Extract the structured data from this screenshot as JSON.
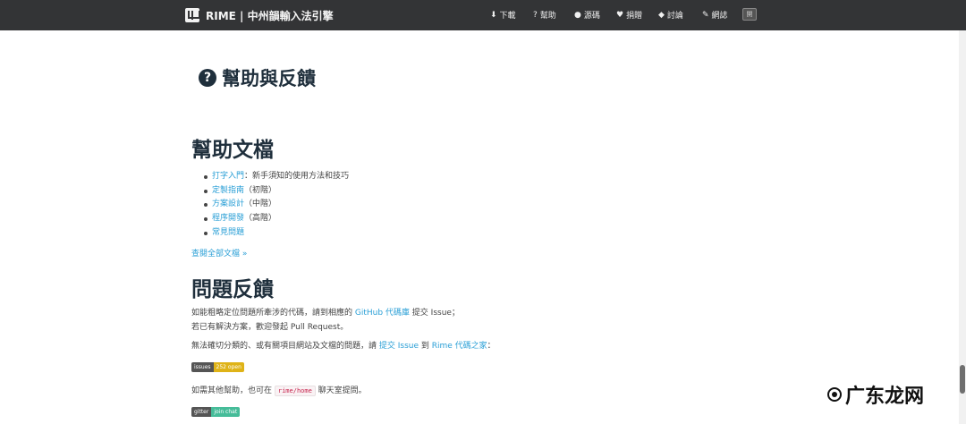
{
  "navbar": {
    "brand": "RIME | 中州韻輸入法引擎",
    "items": [
      {
        "icon": "⬇",
        "icon_name": "download-icon",
        "label": "下載"
      },
      {
        "icon": "?",
        "icon_name": "question-icon",
        "label": "幫助"
      },
      {
        "icon": "●",
        "icon_name": "github-icon",
        "label": "源碼"
      },
      {
        "icon": "♥",
        "icon_name": "heart-icon",
        "label": "捐贈"
      },
      {
        "icon": "◆",
        "icon_name": "chat-icon",
        "label": "討論"
      },
      {
        "icon": "✎",
        "icon_name": "edit-icon",
        "label": "網誌"
      }
    ],
    "toggle": "開"
  },
  "page": {
    "title": "幫助與反饋",
    "title_icon": "?"
  },
  "docs": {
    "heading": "幫助文檔",
    "items": [
      {
        "link": "打字入門",
        "desc": "：新手須知的使用方法和技巧"
      },
      {
        "link": "定製指南",
        "desc": "（初階）"
      },
      {
        "link": "方案設計",
        "desc": "（中階）"
      },
      {
        "link": "程序開發",
        "desc": "（高階）"
      },
      {
        "link": "常見問題",
        "desc": ""
      }
    ],
    "more": "查閱全部文檔 »"
  },
  "feedback": {
    "heading": "問題反饋",
    "p1_a": "如能粗略定位問題所牽涉的代碼，請到相應的 ",
    "p1_link": "GitHub 代碼庫",
    "p1_b": " 提交 Issue；",
    "p2": "若已有解決方案，歡迎發起 Pull Request。",
    "p3_a": "無法確切分類的、或有關項目網站及文檔的問題，請 ",
    "p3_link1": "提交 Issue",
    "p3_b": " 到 ",
    "p3_link2": "Rime 代碼之家",
    "p3_c": "：",
    "badge_issues_left": "issues",
    "badge_issues_right": "252 open",
    "badge_issues_color": "#dfb317",
    "p4_a": "如需其他幫助，也可在 ",
    "p4_code": "rime/home",
    "p4_b": " 聊天室提問。",
    "badge_gitter_left": "gitter",
    "badge_gitter_right": "join chat",
    "badge_gitter_color": "#46bc99"
  },
  "watermark": {
    "text": "广东龙网"
  }
}
